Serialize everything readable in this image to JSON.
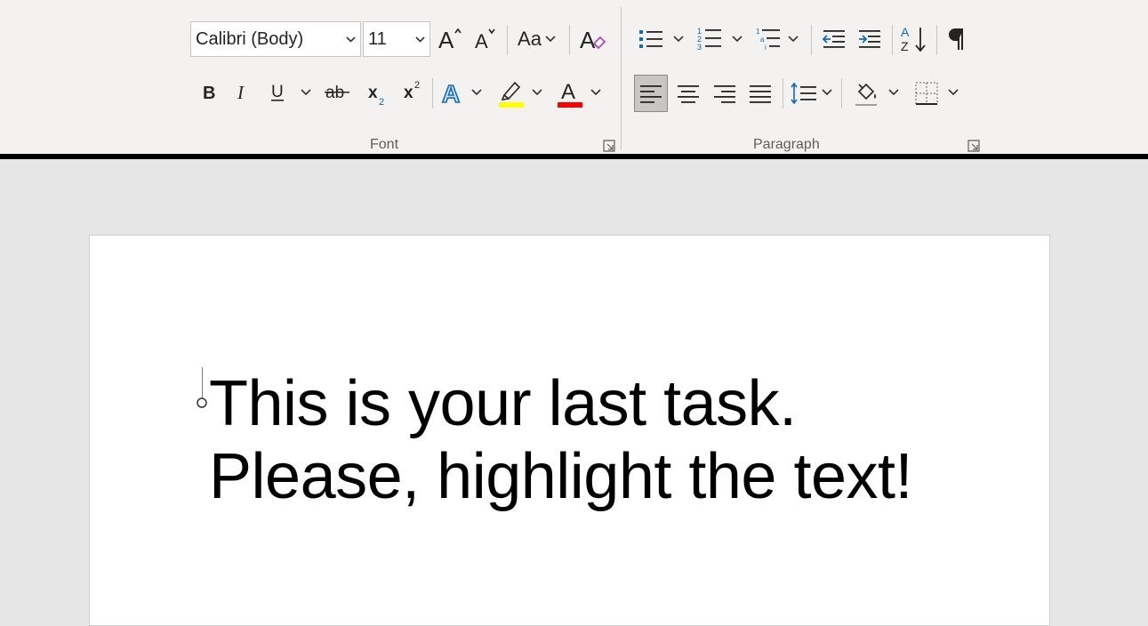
{
  "ribbon": {
    "font_group": {
      "label": "Font",
      "font_name": "Calibri (Body)",
      "font_size": "11",
      "change_case_label": "Aa",
      "highlight_color": "#ffff00",
      "font_color": "#ff0000"
    },
    "paragraph_group": {
      "label": "Paragraph"
    }
  },
  "document": {
    "line1": "This is your last task.",
    "line2": "Please, highlight the text!"
  }
}
